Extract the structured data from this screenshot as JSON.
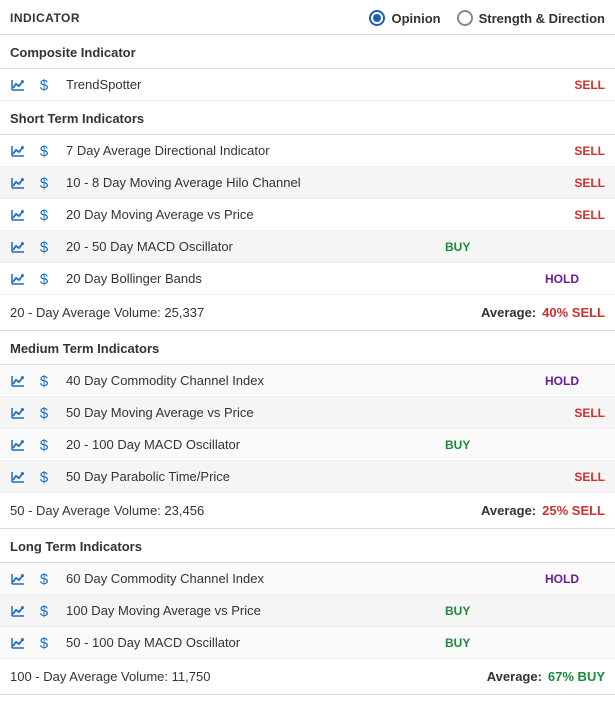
{
  "header": {
    "title": "INDICATOR",
    "radios": {
      "opinion": "Opinion",
      "strength": "Strength & Direction"
    }
  },
  "sections": [
    {
      "title": "Composite Indicator",
      "rows": [
        {
          "name": "TrendSpotter",
          "signal": "SELL"
        }
      ],
      "summary": null
    },
    {
      "title": "Short Term Indicators",
      "rows": [
        {
          "name": "7 Day Average Directional Indicator",
          "signal": "SELL"
        },
        {
          "name": "10 - 8 Day Moving Average Hilo Channel",
          "signal": "SELL"
        },
        {
          "name": "20 Day Moving Average vs Price",
          "signal": "SELL"
        },
        {
          "name": "20 - 50 Day MACD Oscillator",
          "signal": "BUY"
        },
        {
          "name": "20 Day Bollinger Bands",
          "signal": "HOLD"
        }
      ],
      "summary": {
        "text": "20 - Day Average Volume: 25,337",
        "avg_label": "Average:",
        "avg_value": "40% SELL",
        "avg_class": "SELL"
      }
    },
    {
      "title": "Medium Term Indicators",
      "rows": [
        {
          "name": "40 Day Commodity Channel Index",
          "signal": "HOLD"
        },
        {
          "name": "50 Day Moving Average vs Price",
          "signal": "SELL"
        },
        {
          "name": "20 - 100 Day MACD Oscillator",
          "signal": "BUY"
        },
        {
          "name": "50 Day Parabolic Time/Price",
          "signal": "SELL"
        }
      ],
      "summary": {
        "text": "50 - Day Average Volume: 23,456",
        "avg_label": "Average:",
        "avg_value": "25% SELL",
        "avg_class": "SELL"
      }
    },
    {
      "title": "Long Term Indicators",
      "rows": [
        {
          "name": "60 Day Commodity Channel Index",
          "signal": "HOLD"
        },
        {
          "name": "100 Day Moving Average vs Price",
          "signal": "BUY"
        },
        {
          "name": "50 - 100 Day MACD Oscillator",
          "signal": "BUY"
        }
      ],
      "summary": {
        "text": "100 - Day Average Volume: 11,750",
        "avg_label": "Average:",
        "avg_value": "67% BUY",
        "avg_class": "BUY"
      }
    }
  ]
}
